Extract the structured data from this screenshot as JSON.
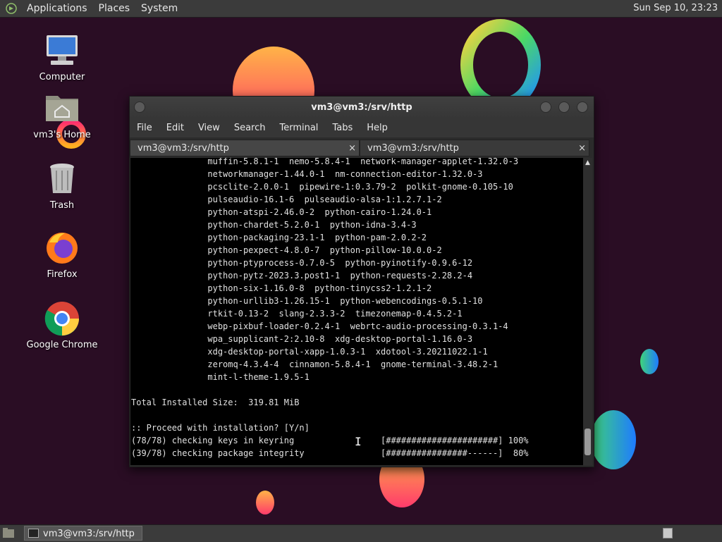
{
  "top_panel": {
    "menus": [
      "Applications",
      "Places",
      "System"
    ],
    "clock": "Sun Sep 10, 23:23"
  },
  "desktop_icons": [
    {
      "label": "Computer",
      "icon": "computer-icon"
    },
    {
      "label": "vm3's Home",
      "icon": "home-folder-icon"
    },
    {
      "label": "Trash",
      "icon": "trash-icon"
    },
    {
      "label": "Firefox",
      "icon": "firefox-icon"
    },
    {
      "label": "Google Chrome",
      "icon": "chrome-icon"
    }
  ],
  "terminal": {
    "title": "vm3@vm3:/srv/http",
    "menu": [
      "File",
      "Edit",
      "View",
      "Search",
      "Terminal",
      "Tabs",
      "Help"
    ],
    "tabs": [
      {
        "label": "vm3@vm3:/srv/http",
        "close": "×"
      },
      {
        "label": "vm3@vm3:/srv/http",
        "close": "×"
      }
    ],
    "output": "               muffin-5.8.1-1  nemo-5.8.4-1  network-manager-applet-1.32.0-3\n               networkmanager-1.44.0-1  nm-connection-editor-1.32.0-3\n               pcsclite-2.0.0-1  pipewire-1:0.3.79-2  polkit-gnome-0.105-10\n               pulseaudio-16.1-6  pulseaudio-alsa-1:1.2.7.1-2\n               python-atspi-2.46.0-2  python-cairo-1.24.0-1\n               python-chardet-5.2.0-1  python-idna-3.4-3\n               python-packaging-23.1-1  python-pam-2.0.2-2\n               python-pexpect-4.8.0-7  python-pillow-10.0.0-2\n               python-ptyprocess-0.7.0-5  python-pyinotify-0.9.6-12\n               python-pytz-2023.3.post1-1  python-requests-2.28.2-4\n               python-six-1.16.0-8  python-tinycss2-1.2.1-2\n               python-urllib3-1.26.15-1  python-webencodings-0.5.1-10\n               rtkit-0.13-2  slang-2.3.3-2  timezonemap-0.4.5.2-1\n               webp-pixbuf-loader-0.2.4-1  webrtc-audio-processing-0.3.1-4\n               wpa_supplicant-2:2.10-8  xdg-desktop-portal-1.16.0-3\n               xdg-desktop-portal-xapp-1.0.3-1  xdotool-3.20211022.1-1\n               zeromq-4.3.4-4  cinnamon-5.8.4-1  gnome-terminal-3.48.2-1\n               mint-l-theme-1.9.5-1\n\nTotal Installed Size:  319.81 MiB\n\n:: Proceed with installation? [Y/n]\n(78/78) checking keys in keyring                 [######################] 100%\n(39/78) checking package integrity               [################------]  80%"
  },
  "taskbar": {
    "task_label": "vm3@vm3:/srv/http"
  },
  "colors": {
    "desktop": "#2a0d24",
    "panel": "#3b3b3b",
    "terminal_bg": "#000000",
    "terminal_fg": "#e0e0e0"
  }
}
